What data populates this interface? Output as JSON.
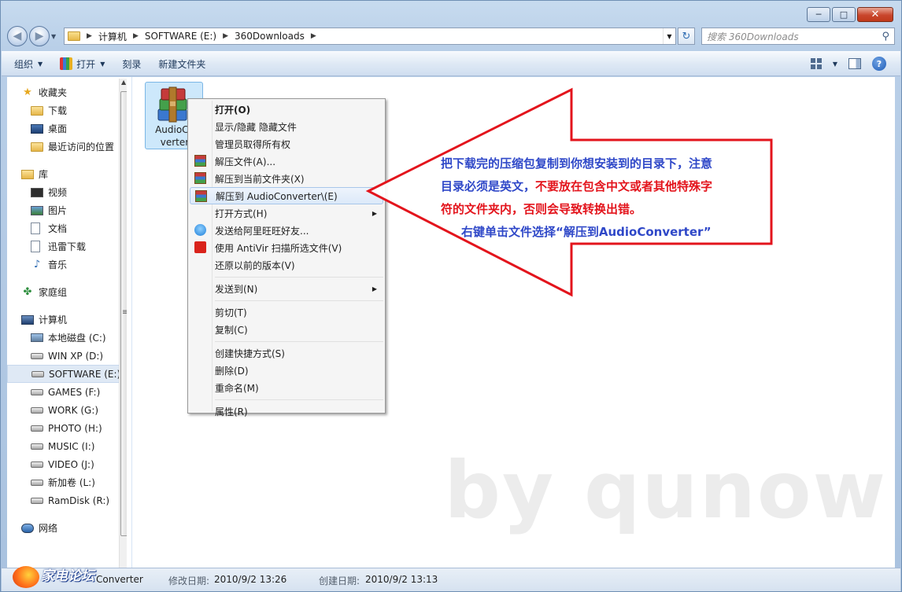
{
  "window": {
    "minimize_glyph": "─",
    "maximize_glyph": "□",
    "close_glyph": "✕"
  },
  "address": {
    "crumbs": [
      "计算机",
      "SOFTWARE (E:)",
      "360Downloads"
    ],
    "search_placeholder": "搜索 360Downloads"
  },
  "toolbar": {
    "organize": "组织",
    "open": "打开",
    "burn": "刻录",
    "new_folder": "新建文件夹"
  },
  "nav": {
    "favorites": "收藏夹",
    "downloads": "下载",
    "desktop": "桌面",
    "recent": "最近访问的位置",
    "libraries": "库",
    "videos": "视频",
    "pictures": "图片",
    "documents": "文档",
    "xunlei": "迅雷下载",
    "music": "音乐",
    "homegroup": "家庭组",
    "computer": "计算机",
    "drives": [
      "本地磁盘 (C:)",
      "WIN XP (D:)",
      "SOFTWARE (E:)",
      "GAMES (F:)",
      "WORK (G:)",
      "PHOTO (H:)",
      "MUSIC (I:)",
      "VIDEO (J:)",
      "新加卷 (L:)",
      "RamDisk (R:)"
    ],
    "network": "网络"
  },
  "file": {
    "label_line1": "AudioCo",
    "label_line2": "verter"
  },
  "context_menu": {
    "items": [
      "打开(O)",
      "显示/隐藏 隐藏文件",
      "管理员取得所有权",
      "解压文件(A)...",
      "解压到当前文件夹(X)",
      "解压到 AudioConverter\\(E)",
      "打开方式(H)",
      "发送给阿里旺旺好友...",
      "使用 AntiVir 扫描所选文件(V)",
      "还原以前的版本(V)",
      "发送到(N)",
      "剪切(T)",
      "复制(C)",
      "创建快捷方式(S)",
      "删除(D)",
      "重命名(M)",
      "属性(R)"
    ]
  },
  "annotation": {
    "line1": "把下载完的压缩包复制到你想安装到的目录下，注意",
    "line2_blue": "目录必须是英文，",
    "line2_red": "不要放在包含中文或者其他特殊字",
    "line3": "符的文件夹内，否则会导致转换出错。",
    "line4": "右键单击文件选择“解压到AudioConverter”",
    "arrow_color": "#e3141c"
  },
  "watermark": "by qunow",
  "status": {
    "name": "Converter",
    "modified_label": "修改日期:",
    "modified_value": "2010/9/2 13:26",
    "created_label": "创建日期:",
    "created_value": "2010/9/2 13:13"
  },
  "forum_logo_text": "家电论坛"
}
